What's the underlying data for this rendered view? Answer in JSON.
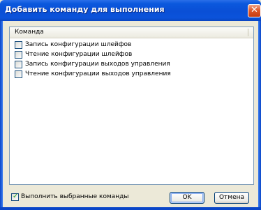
{
  "window": {
    "title": "Добавить команду для выполнения"
  },
  "title_close_glyph": "✕",
  "list": {
    "column_header": "Команда",
    "items": [
      {
        "label": "Запись конфигурации шлейфов",
        "checked": false
      },
      {
        "label": "Чтение конфигурации шлейфов",
        "checked": false
      },
      {
        "label": "Запись конфигурации выходов управления",
        "checked": false
      },
      {
        "label": "Чтение конфигурации выходов управления",
        "checked": false
      }
    ]
  },
  "footer": {
    "execute_selected_label": "Выполнить выбранные команды",
    "execute_selected_checked": true,
    "check_glyph": "✓",
    "ok_label": "OK",
    "cancel_label": "Отмена"
  }
}
